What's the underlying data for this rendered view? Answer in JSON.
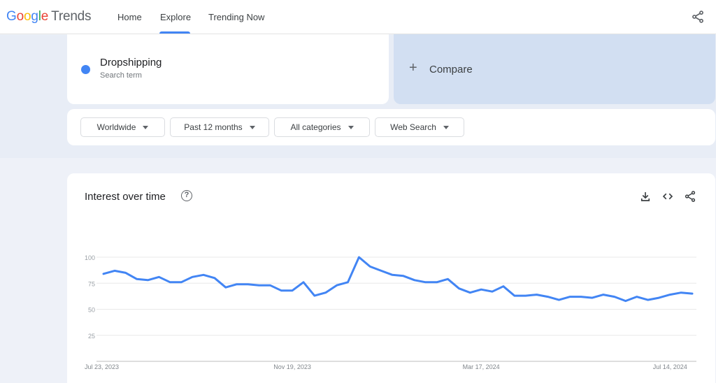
{
  "header": {
    "logo_google": [
      "G",
      "o",
      "o",
      "g",
      "l",
      "e"
    ],
    "logo_product": "Trends",
    "nav": [
      {
        "label": "Home",
        "active": false
      },
      {
        "label": "Explore",
        "active": true
      },
      {
        "label": "Trending Now",
        "active": false
      }
    ],
    "share_icon": "share-icon"
  },
  "search": {
    "term": "Dropshipping",
    "term_type": "Search term",
    "term_color": "#4285f4",
    "compare_label": "Compare"
  },
  "filters": [
    {
      "label": "Worldwide"
    },
    {
      "label": "Past 12 months"
    },
    {
      "label": "All categories"
    },
    {
      "label": "Web Search"
    }
  ],
  "interest": {
    "title": "Interest over time",
    "help_icon": "?",
    "tools": [
      "download-icon",
      "embed-icon",
      "share-icon"
    ]
  },
  "chart_data": {
    "type": "line",
    "title": "Interest over time",
    "xlabel": "",
    "ylabel": "",
    "ylim": [
      0,
      100
    ],
    "yticks": [
      25,
      50,
      75,
      100
    ],
    "x_tick_labels": [
      {
        "label": "Jul 23, 2023",
        "index": 0
      },
      {
        "label": "Nov 19, 2023",
        "index": 17
      },
      {
        "label": "Mar 17, 2024",
        "index": 34
      },
      {
        "label": "Jul 14, 2024",
        "index": 51
      }
    ],
    "grid": true,
    "series": [
      {
        "name": "Dropshipping",
        "color": "#4285f4",
        "values": [
          84,
          87,
          85,
          79,
          78,
          81,
          76,
          76,
          81,
          83,
          80,
          71,
          74,
          74,
          73,
          73,
          68,
          68,
          76,
          63,
          66,
          73,
          76,
          100,
          91,
          87,
          83,
          82,
          78,
          76,
          76,
          79,
          70,
          66,
          69,
          67,
          72,
          63,
          63,
          64,
          62,
          59,
          62,
          62,
          61,
          64,
          62,
          58,
          62,
          59,
          61,
          64,
          66,
          65
        ]
      }
    ]
  }
}
